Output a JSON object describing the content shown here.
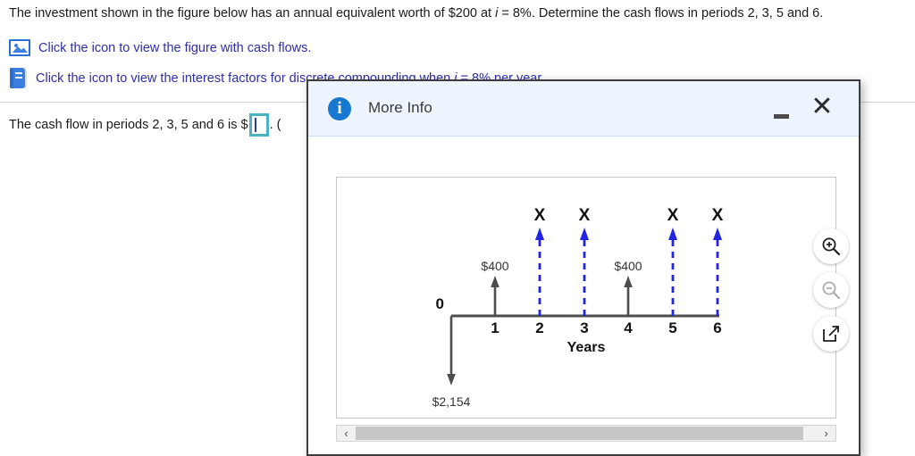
{
  "question": {
    "stem_part1": "The investment shown in the figure below has an annual equivalent worth of $200 at ",
    "stem_i1": "i",
    "stem_part2": " = 8%. Determine the cash flows in periods 2, 3, 5 and 6.",
    "link1_label": "Click the icon to view the figure with cash flows.",
    "link2_part1": "Click the icon to view the interest factors for discrete compounding when ",
    "link2_i": "i",
    "link2_part2": " = 8% per year.",
    "link1_icon": "picture-icon",
    "link2_icon": "book-icon",
    "link_color": "#2f2fa8"
  },
  "answer": {
    "prefix": "The cash flow in periods 2, 3, 5 and 6 is $",
    "value": "",
    "suffix": ". (",
    "input_border_color": "#49b3c4"
  },
  "dialog": {
    "title": "More Info",
    "icon": "info-icon",
    "icon_glyph": "i",
    "minimize_label": "minimize",
    "close_label": "✕",
    "header_bg": "#eef4fd",
    "tools": [
      {
        "name": "zoom-in-icon",
        "enabled": true
      },
      {
        "name": "zoom-out-icon",
        "enabled": false
      },
      {
        "name": "open-in-new-window-icon",
        "enabled": true
      }
    ],
    "scrollbar": {
      "left_arrow": "‹",
      "right_arrow": "›",
      "thumb_percent": 97
    }
  },
  "chart_data": {
    "type": "cash-flow-diagram",
    "title": "",
    "xlabel": "Years",
    "axis_label_zero": "0",
    "x_ticks": [
      "1",
      "2",
      "3",
      "4",
      "5",
      "6"
    ],
    "series": [
      {
        "name": "known-inflows",
        "color": "#404040",
        "style": "solid",
        "direction": "up",
        "points": [
          {
            "period": 1,
            "label": "$400",
            "value": 400
          },
          {
            "period": 4,
            "label": "$400",
            "value": 400
          }
        ]
      },
      {
        "name": "unknown-inflows",
        "color": "#2323e6",
        "style": "dashed",
        "direction": "up",
        "points": [
          {
            "period": 2,
            "label": "X",
            "value": null
          },
          {
            "period": 3,
            "label": "X",
            "value": null
          },
          {
            "period": 5,
            "label": "X",
            "value": null
          },
          {
            "period": 6,
            "label": "X",
            "value": null
          }
        ]
      },
      {
        "name": "initial-outflow",
        "color": "#404040",
        "style": "solid",
        "direction": "down",
        "points": [
          {
            "period": 0,
            "label": "$2,154",
            "value": -2154
          }
        ]
      }
    ]
  }
}
